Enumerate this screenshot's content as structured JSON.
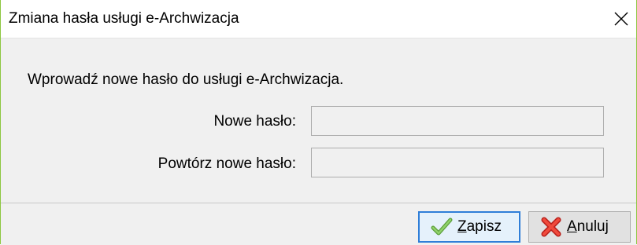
{
  "window": {
    "title": "Zmiana hasła usługi e-Archwizacja"
  },
  "form": {
    "instruction": "Wprowadź nowe hasło do usługi e-Archwizacja.",
    "new_password_label": "Nowe hasło:",
    "new_password_value": "",
    "repeat_password_label": "Powtórz nowe hasło:",
    "repeat_password_value": ""
  },
  "buttons": {
    "save_mnemonic": "Z",
    "save_rest": "apisz",
    "save_icon": "checkmark-icon",
    "cancel_mnemonic": "A",
    "cancel_rest": "nuluj",
    "cancel_icon": "red-x-icon"
  },
  "colors": {
    "frame_border": "#8cc63f",
    "save_focus_border": "#2f7ed8",
    "save_check": "#6ab04c",
    "cancel_x": "#e0312b"
  }
}
